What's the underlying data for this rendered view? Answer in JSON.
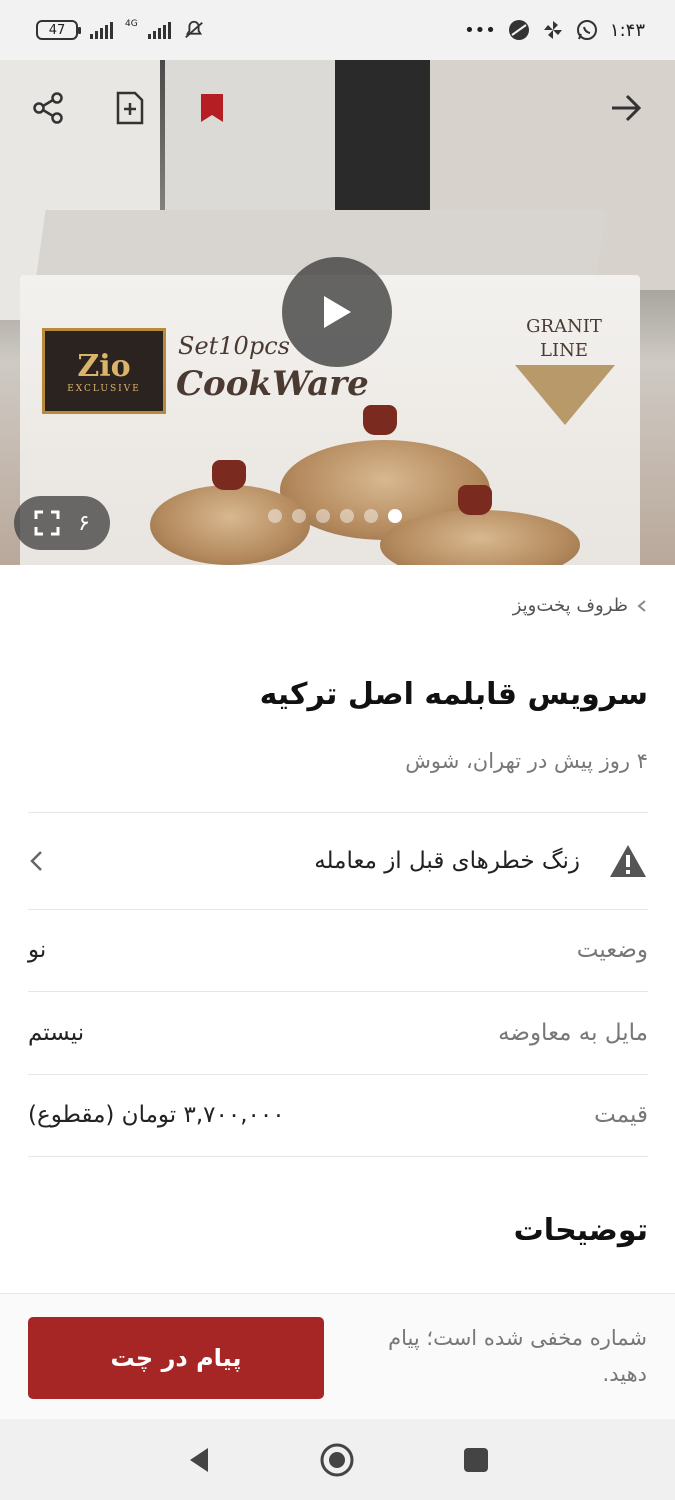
{
  "status_bar": {
    "battery": "47",
    "network": "4G",
    "time": "۱:۴۳",
    "more": "•••"
  },
  "hero": {
    "image_count": "۶",
    "dots_total": 6,
    "active_dot": 6,
    "box_brand": "Zio",
    "box_brand_sub": "EXCLUSIVE",
    "box_set": "Set10pcs",
    "box_name": "CookWare",
    "box_line_1": "GRANIT",
    "box_line_2": "LINE"
  },
  "listing": {
    "breadcrumb": "ظروف پخت‌وپز",
    "title": "سرویس قابلمه اصل ترکیه",
    "meta": "۴ روز پیش در تهران، شوش",
    "warning": "زنگ خطرهای قبل از معامله",
    "rows": [
      {
        "label": "وضعیت",
        "value": "نو"
      },
      {
        "label": "مایل به معاوضه",
        "value": "نیستم"
      },
      {
        "label": "قیمت",
        "value": "۳,۷۰۰,۰۰۰ تومان (مقطوع)"
      }
    ],
    "description_title": "توضیحات"
  },
  "actions": {
    "chat_button": "پیام در چت",
    "hidden_note": "شماره مخفی شده است؛ پیام دهید."
  },
  "colors": {
    "accent": "#a62626",
    "bookmark": "#b51f23"
  }
}
